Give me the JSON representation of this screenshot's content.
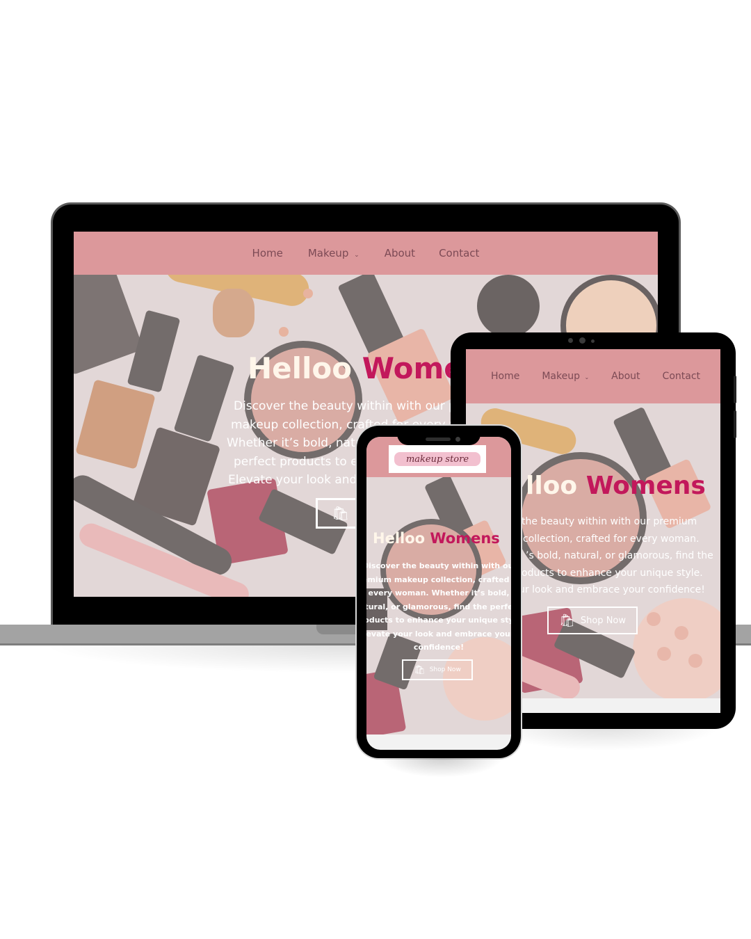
{
  "site": {
    "nav": [
      "Home",
      "Makeup",
      "About",
      "Contact"
    ],
    "dropdown_icon": "chevron-down-icon",
    "logo_text": "makeup store",
    "hero": {
      "title_part1": "Helloo",
      "title_part2": "Womens",
      "description": "Discover the beauty within with our premium makeup collection, crafted for every woman. Whether it’s bold, natural, or glamorous, find the perfect products to enhance your unique style. Elevate your look and embrace your confidence!",
      "button_label": "Shop Now",
      "button_icon": "shopping-bag-heart-icon"
    }
  },
  "laptop_view": {
    "title_part2": "Wome",
    "description_lines": [
      "Discover the beauty within with our p",
      "makeup collection, crafted for every w",
      "Whether it’s bold, natur",
      "perfect products to er",
      "Elevate your look and e"
    ]
  },
  "tablet_view": {
    "title_part1": "lloo",
    "description_lines": [
      "the beauty within with our premium",
      "collection, crafted for every woman.",
      "’s bold, natural, or glamorous, find the",
      "oducts to enhance your unique style.",
      "ur look and embrace your confidence!"
    ]
  },
  "phone_view": {
    "description_lines": [
      "Discover the beauty within with our",
      "emium makeup collection, crafted f",
      "every woman. Whether it’s bold,",
      "tural, or glamorous, find the perfe",
      "oducts to enhance your unique sty",
      "levate your look and embrace your",
      "confidence!"
    ]
  },
  "colors": {
    "nav_bg": "#dc989b",
    "nav_text": "#7c4a55",
    "accent": "#c2185b",
    "title_light": "#fff6ea"
  }
}
